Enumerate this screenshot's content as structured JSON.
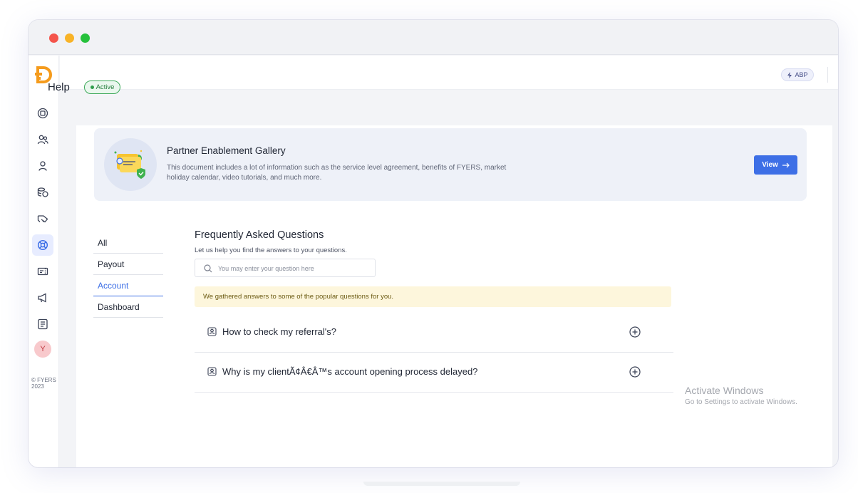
{
  "window": {
    "title_dots": [
      "close",
      "minimize",
      "maximize"
    ]
  },
  "sidebar": {
    "logo_icon": "fyers-logo-icon",
    "items": [
      {
        "icon": "dashboard-icon"
      },
      {
        "icon": "users-icon"
      },
      {
        "icon": "user-icon"
      },
      {
        "icon": "payout-icon"
      },
      {
        "icon": "handshake-icon"
      },
      {
        "icon": "help-lifebuoy-icon",
        "active": true
      },
      {
        "icon": "ticket-icon"
      },
      {
        "icon": "megaphone-icon"
      },
      {
        "icon": "list-icon"
      }
    ],
    "avatar_initial": "Y",
    "copyright": "© FYERS 2023"
  },
  "topbar": {
    "abp_label": "ABP",
    "apps_icon": "grid-icon"
  },
  "page": {
    "title": "Help",
    "status_badge": "Active"
  },
  "banner": {
    "title": "Partner Enablement Gallery",
    "description": "This document includes a lot of information such as the service level agreement, benefits of FYERS, market holiday calendar, video tutorials, and much more.",
    "button_label": "View"
  },
  "tabs": [
    {
      "label": "All"
    },
    {
      "label": "Payout"
    },
    {
      "label": "Account",
      "active": true
    },
    {
      "label": "Dashboard"
    }
  ],
  "faq": {
    "title": "Frequently Asked Questions",
    "subtitle": "Let us help you find the answers to your questions.",
    "search_placeholder": "You may enter your question here",
    "notice": "We gathered answers to some of the popular questions for you.",
    "questions": [
      {
        "text": "How to check my referral's?"
      },
      {
        "text": "Why is my clientÃ¢Â€Â™s account opening process delayed?"
      }
    ]
  },
  "watermark": {
    "line1": "Activate Windows",
    "line2": "Go to Settings to activate Windows."
  },
  "colors": {
    "accent": "#3d6fe6",
    "active_badge": "#3aa857",
    "notice_bg": "#fdf6dc",
    "logo": "#f59b1c"
  }
}
